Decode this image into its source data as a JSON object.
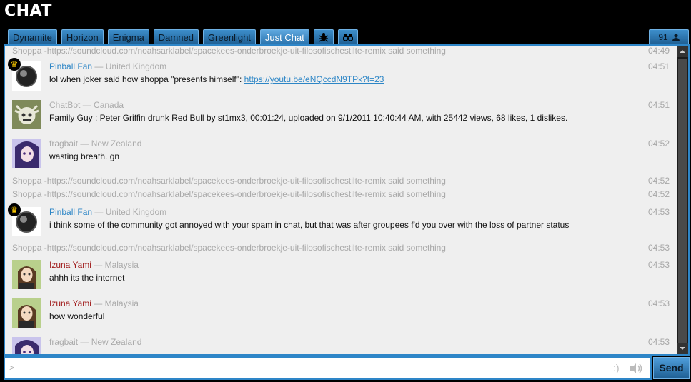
{
  "title": "CHAT",
  "tabs": [
    "Dynamite",
    "Horizon",
    "Enigma",
    "Damned",
    "Greenlight",
    "Just Chat"
  ],
  "icon_tabs": [
    "bug-icon",
    "binoculars-icon"
  ],
  "user_count": "91",
  "system_message": "Shoppa -https://soundcloud.com/noahsarklabel/spacekees-onderbroekje-uit-filosofischestilte-remix said something",
  "messages": [
    {
      "type": "system",
      "time": "04:49"
    },
    {
      "type": "user",
      "name": "Pinball Fan",
      "location": "— United Kingdom",
      "text": "lol when joker said how shoppa \"presents himself\": ",
      "link": "https://youtu.be/eNQccdN9TPk?t=23",
      "time": "04:51"
    },
    {
      "type": "user",
      "name": "ChatBot",
      "location": "— Canada",
      "text": "Family Guy : Peter Griffin drunk Red Bull by st1mx3, 00:01:24, uploaded on 9/1/2011 10:40:44 AM, with 25442 views, 68 likes, 1 dislikes.",
      "time": "04:51"
    },
    {
      "type": "user",
      "name": "fragbait",
      "location": "— New Zealand",
      "text": "wasting breath. gn",
      "time": "04:52"
    },
    {
      "type": "system",
      "time": "04:52"
    },
    {
      "type": "system",
      "time": "04:52"
    },
    {
      "type": "user",
      "name": "Pinball Fan",
      "location": "— United Kingdom",
      "text": "i think some of the community got annoyed with your spam in chat, but that was after groupees f'd you over with the loss of partner status",
      "time": "04:53"
    },
    {
      "type": "system",
      "time": "04:53"
    },
    {
      "type": "user",
      "name": "Izuna Yami",
      "location": "— Malaysia",
      "text": "ahhh its the internet",
      "time": "04:53"
    },
    {
      "type": "user",
      "name": "Izuna Yami",
      "location": "— Malaysia",
      "text": "how wonderful",
      "time": "04:53"
    },
    {
      "type": "user",
      "name": "fragbait",
      "location": "— New Zealand",
      "text": "",
      "time": "04:53"
    }
  ],
  "input": {
    "prompt": ">",
    "value": "",
    "smiley": ":)"
  },
  "send_label": "Send",
  "colors": {
    "accent": "#2e86c8",
    "name_blue": "#2d86c6",
    "name_red": "#a01c1c",
    "name_gray": "#aaaaaa"
  }
}
